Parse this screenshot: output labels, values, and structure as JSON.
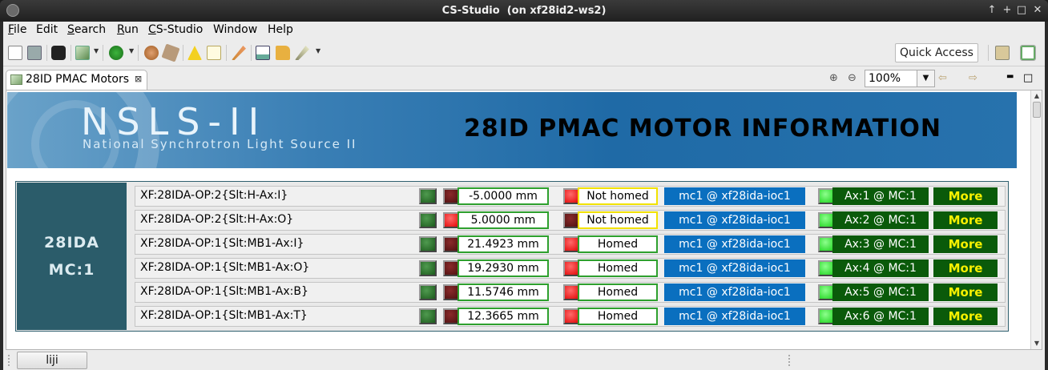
{
  "window": {
    "title": "CS-Studio  (on xf28id2-ws2)",
    "controls": {
      "help": "↑",
      "restore": "+",
      "minimize": "−",
      "maximize": "□",
      "close": "✕"
    }
  },
  "menubar": {
    "items": [
      {
        "label": "File",
        "mnemonic": "F",
        "rest": "ile"
      },
      {
        "label": "Edit",
        "mnemonic": "",
        "rest": "Edit"
      },
      {
        "label": "Search",
        "mnemonic": "S",
        "rest": "earch"
      },
      {
        "label": "Run",
        "mnemonic": "R",
        "rest": "un"
      },
      {
        "label": "CS-Studio",
        "mnemonic": "C",
        "rest": "S-Studio"
      },
      {
        "label": "Window",
        "mnemonic": "",
        "rest": "Window"
      },
      {
        "label": "Help",
        "mnemonic": "",
        "rest": "Help"
      }
    ]
  },
  "toolbar": {
    "quick_access": "Quick Access",
    "icons": [
      "new-window-icon",
      "save-icon",
      "camera-icon",
      "chart-icon",
      "run-icon",
      "people-icon",
      "tag-icon",
      "alarm-icon",
      "note-icon",
      "probe-icon",
      "trend-icon",
      "open-folder-icon",
      "wand-icon",
      "perspective-icon",
      "display-icon"
    ]
  },
  "editor": {
    "tab_label": "28ID PMAC Motors",
    "tab_close": "⊠",
    "zoom": "100%",
    "zoom_in": "⊕",
    "zoom_out": "⊖",
    "nav_back": "⇦",
    "nav_forward": "⇨",
    "minimize": "▬",
    "maximize": "□"
  },
  "banner": {
    "logo_big": "NSLS-II",
    "logo_small": "National Synchrotron Light Source II",
    "title": "28ID PMAC MOTOR INFORMATION"
  },
  "controller": {
    "line1": "28IDA",
    "line2": "MC:1"
  },
  "motors": [
    {
      "pv": "XF:28IDA-OP:2{Slt:H-Ax:I}",
      "led1": "green-dark",
      "led2": "red-dark",
      "value": "-5.0000 mm",
      "led3": "red-bright",
      "homed": "Not homed",
      "ioc": "mc1 @ xf28ida-ioc1",
      "led4": "green-bright",
      "axis": "Ax:1 @ MC:1",
      "more": "More"
    },
    {
      "pv": "XF:28IDA-OP:2{Slt:H-Ax:O}",
      "led1": "green-dark",
      "led2": "red-bright",
      "value": "5.0000 mm",
      "led3": "red-dark",
      "homed": "Not homed",
      "ioc": "mc1 @ xf28ida-ioc1",
      "led4": "green-bright",
      "axis": "Ax:2 @ MC:1",
      "more": "More"
    },
    {
      "pv": "XF:28IDA-OP:1{Slt:MB1-Ax:I}",
      "led1": "green-dark",
      "led2": "red-dark",
      "value": "21.4923 mm",
      "led3": "red-bright",
      "homed": "Homed",
      "ioc": "mc1 @ xf28ida-ioc1",
      "led4": "green-bright",
      "axis": "Ax:3 @ MC:1",
      "more": "More"
    },
    {
      "pv": "XF:28IDA-OP:1{Slt:MB1-Ax:O}",
      "led1": "green-dark",
      "led2": "red-dark",
      "value": "19.2930 mm",
      "led3": "red-bright",
      "homed": "Homed",
      "ioc": "mc1 @ xf28ida-ioc1",
      "led4": "green-bright",
      "axis": "Ax:4 @ MC:1",
      "more": "More"
    },
    {
      "pv": "XF:28IDA-OP:1{Slt:MB1-Ax:B}",
      "led1": "green-dark",
      "led2": "red-dark",
      "value": "11.5746 mm",
      "led3": "red-bright",
      "homed": "Homed",
      "ioc": "mc1 @ xf28ida-ioc1",
      "led4": "green-bright",
      "axis": "Ax:5 @ MC:1",
      "more": "More"
    },
    {
      "pv": "XF:28IDA-OP:1{Slt:MB1-Ax:T}",
      "led1": "green-dark",
      "led2": "red-dark",
      "value": "12.3665 mm",
      "led3": "red-bright",
      "homed": "Homed",
      "ioc": "mc1 @ xf28ida-ioc1",
      "led4": "green-bright",
      "axis": "Ax:6 @ MC:1",
      "more": "More"
    }
  ],
  "statusbar": {
    "user": "liji"
  },
  "colors": {
    "ioc_blue": "#0a6fbf",
    "axis_green": "#0a5a0a",
    "more_yellow": "#f6f000",
    "homed_border": "#2ea02e",
    "not_homed_border": "#f2e200",
    "controller_bg": "#2b5c6a"
  }
}
